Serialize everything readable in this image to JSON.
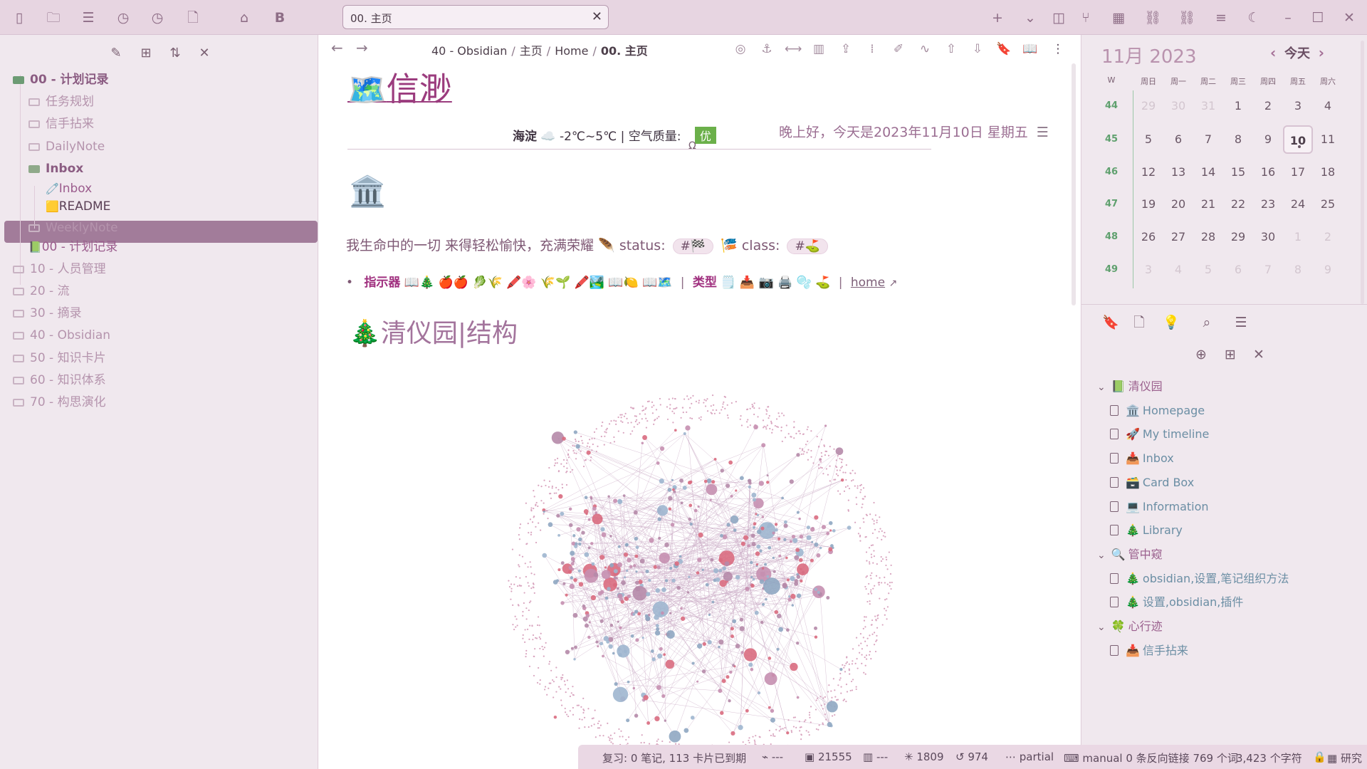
{
  "app": {
    "top_icons_left": [
      "sidebar-toggle-icon",
      "folder-icon",
      "stack-icon",
      "clock-icon",
      "clock-icon",
      "file-pin-icon",
      "tags-icon",
      "bold-b-icon"
    ],
    "tab": {
      "title": "00. 主页",
      "close": "✕"
    },
    "top_icons_right": [
      "plus-icon",
      "chevron-down-icon",
      "right-sidebar-icon",
      "git-branch-icon",
      "calendar-icon",
      "link-icon",
      "link-icon",
      "list-icon",
      "moon-icon"
    ],
    "window_controls": [
      "minimize",
      "maximize",
      "close"
    ]
  },
  "left_sidebar": {
    "tools": [
      "new-note-icon",
      "new-folder-icon",
      "sort-icon",
      "collapse-icon"
    ],
    "tree": [
      {
        "label": "00 - 计划记录",
        "bold": true,
        "dark": true,
        "folder": "open-green"
      },
      {
        "label": "任务规划"
      },
      {
        "label": "信手拈来"
      },
      {
        "label": "DailyNote"
      },
      {
        "label": "Inbox",
        "bold": true,
        "dark": true,
        "folder": "open"
      },
      {
        "label": "Inbox",
        "emoji": "🧷"
      },
      {
        "label": "README",
        "emoji": "🟨"
      },
      {
        "label": "WeeklyNote"
      },
      {
        "label": "00 - 计划记录",
        "emoji": "📗"
      },
      {
        "label": "10 - 人员管理"
      },
      {
        "label": "20 - 流"
      },
      {
        "label": "30 - 摘录"
      },
      {
        "label": "40 - Obsidian"
      },
      {
        "label": "50 - 知识卡片"
      },
      {
        "label": "60 - 知识体系"
      },
      {
        "label": "70 - 构思演化"
      }
    ]
  },
  "main": {
    "breadcrumb": [
      "40 - Obsidian",
      "主页",
      "Home",
      "00. 主页"
    ],
    "title": "信渺",
    "title_icon": "🗺️",
    "weather": {
      "location": "海淀",
      "icon": "☁️",
      "temp": "-2℃~5℃",
      "sep": "|",
      "aq_label": "空气质量:",
      "aq_value": "优"
    },
    "greeting": "晚上好，今天是2023年11月10日 星期五",
    "omega": "Ω",
    "bank_icon": "🏛️",
    "motto": "我生命中的一切 来得轻松愉快，充满荣耀",
    "status_label": "status:",
    "status_tag": "#🏁",
    "class_label": "class:",
    "class_tag": "#⛳",
    "indicator_label": "指示器",
    "indicator_emojis": "📖🎄 🍎🍎 🥬🌾 🖍️🌸 🌾🌱 🖍️🏞️ 📖🍋 📖🗺️",
    "type_label": "类型",
    "type_emojis": "🗒️ 📥 📷 🖨️ 🫧 ⛳",
    "home_link": "home",
    "section_heading": "清仪园|结构",
    "section_icon": "🎄"
  },
  "calendar": {
    "month": "11月 2023",
    "today_btn": "今天",
    "headers": [
      "W",
      "周日",
      "周一",
      "周二",
      "周三",
      "周四",
      "周五",
      "周六"
    ],
    "weeks": [
      {
        "wk": "44",
        "days": [
          "29",
          "30",
          "31",
          "1",
          "2",
          "3",
          "4"
        ],
        "dim": [
          0,
          1,
          2
        ]
      },
      {
        "wk": "45",
        "days": [
          "5",
          "6",
          "7",
          "8",
          "9",
          "10",
          "11"
        ],
        "dim": []
      },
      {
        "wk": "46",
        "days": [
          "12",
          "13",
          "14",
          "15",
          "16",
          "17",
          "18"
        ],
        "dim": []
      },
      {
        "wk": "47",
        "days": [
          "19",
          "20",
          "21",
          "22",
          "23",
          "24",
          "25"
        ],
        "dim": []
      },
      {
        "wk": "48",
        "days": [
          "26",
          "27",
          "28",
          "29",
          "30",
          "1",
          "2"
        ],
        "dim": [
          5,
          6
        ]
      },
      {
        "wk": "49",
        "days": [
          "3",
          "4",
          "5",
          "6",
          "7",
          "8",
          "9"
        ],
        "dim": [
          0,
          1,
          2,
          3,
          4,
          5,
          6
        ]
      }
    ],
    "today": "10"
  },
  "bookmarks": {
    "tools": [
      "bookmark-icon",
      "file-pin-icon",
      "lightbulb-icon",
      "search-icon",
      "list-icon"
    ],
    "subtools": [
      "add-bookmark-icon",
      "new-group-icon",
      "collapse-icon"
    ],
    "items": [
      {
        "type": "group",
        "label": "清仪园",
        "emoji": "📗"
      },
      {
        "type": "item",
        "label": "Homepage",
        "emoji": "🏛️"
      },
      {
        "type": "item",
        "label": "My timeline",
        "emoji": "🚀"
      },
      {
        "type": "item",
        "label": "Inbox",
        "emoji": "📥"
      },
      {
        "type": "item",
        "label": "Card Box",
        "emoji": "🗃️"
      },
      {
        "type": "item",
        "label": "Information",
        "emoji": "💻"
      },
      {
        "type": "item",
        "label": "Library",
        "emoji": "🎄"
      },
      {
        "type": "group",
        "label": "管中窥",
        "emoji": "🔍"
      },
      {
        "type": "item",
        "label": "obsidian,设置,笔记组织方法",
        "emoji": "🎄"
      },
      {
        "type": "item",
        "label": "设置,obsidian,插件",
        "emoji": "🎄"
      },
      {
        "type": "group",
        "label": "心行迹",
        "emoji": "🍀"
      },
      {
        "type": "item",
        "label": "信手拈来",
        "emoji": "📥"
      }
    ]
  },
  "statusbar": {
    "review": "复习: 0 笔记, 113 卡片已到期",
    "s1": "---",
    "s2": "21555",
    "s3": "---",
    "s4": "1809",
    "s5": "974",
    "s6": "partial",
    "s7": "manual 0 条反向链接 769 个词",
    "s8": "3,423 个字符",
    "s9": "研究"
  },
  "colors": {
    "accent": "#9b3c7e",
    "top_bar": "#e7d5e1",
    "sidebar": "#f0e8ee",
    "selected": "#a27c9a",
    "aq_good": "#6bb04a"
  }
}
